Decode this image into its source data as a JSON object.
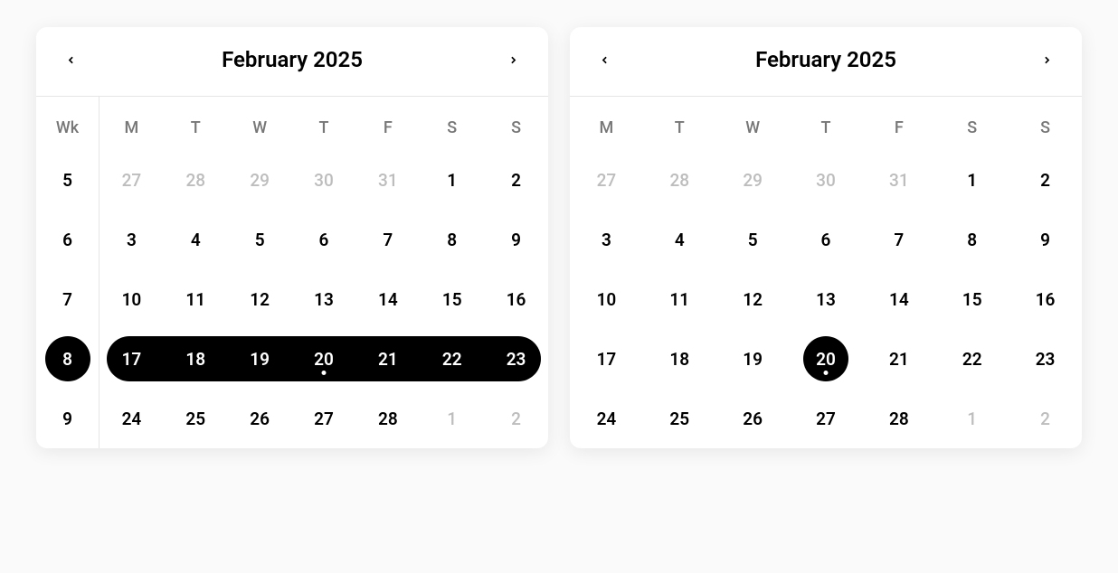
{
  "calendars": [
    {
      "id": "left",
      "title": "February 2025",
      "showWeekNumbers": true,
      "weekLabel": "Wk",
      "dayHeaders": [
        "M",
        "T",
        "W",
        "T",
        "F",
        "S",
        "S"
      ],
      "selectedWeek": 8,
      "todayDay": 20,
      "rangeStart": 17,
      "rangeEnd": 23,
      "rows": [
        {
          "wk": 5,
          "wkSelected": false,
          "days": [
            {
              "n": 27,
              "muted": true
            },
            {
              "n": 28,
              "muted": true
            },
            {
              "n": 29,
              "muted": true
            },
            {
              "n": 30,
              "muted": true
            },
            {
              "n": 31,
              "muted": true
            },
            {
              "n": 1
            },
            {
              "n": 2
            }
          ]
        },
        {
          "wk": 6,
          "wkSelected": false,
          "days": [
            {
              "n": 3
            },
            {
              "n": 4
            },
            {
              "n": 5
            },
            {
              "n": 6
            },
            {
              "n": 7
            },
            {
              "n": 8
            },
            {
              "n": 9
            }
          ]
        },
        {
          "wk": 7,
          "wkSelected": false,
          "days": [
            {
              "n": 10
            },
            {
              "n": 11
            },
            {
              "n": 12
            },
            {
              "n": 13
            },
            {
              "n": 14
            },
            {
              "n": 15
            },
            {
              "n": 16
            }
          ]
        },
        {
          "wk": 8,
          "wkSelected": true,
          "days": [
            {
              "n": 17,
              "inRange": true,
              "rangeEdge": "left"
            },
            {
              "n": 18,
              "inRange": true
            },
            {
              "n": 19,
              "inRange": true
            },
            {
              "n": 20,
              "inRange": true,
              "today": true
            },
            {
              "n": 21,
              "inRange": true
            },
            {
              "n": 22,
              "inRange": true
            },
            {
              "n": 23,
              "inRange": true,
              "rangeEdge": "right"
            }
          ]
        },
        {
          "wk": 9,
          "wkSelected": false,
          "days": [
            {
              "n": 24
            },
            {
              "n": 25
            },
            {
              "n": 26
            },
            {
              "n": 27
            },
            {
              "n": 28
            },
            {
              "n": 1,
              "muted": true
            },
            {
              "n": 2,
              "muted": true
            }
          ]
        }
      ]
    },
    {
      "id": "right",
      "title": "February 2025",
      "showWeekNumbers": false,
      "dayHeaders": [
        "M",
        "T",
        "W",
        "T",
        "F",
        "S",
        "S"
      ],
      "selectedDay": 20,
      "todayDay": 20,
      "rows": [
        {
          "days": [
            {
              "n": 27,
              "muted": true
            },
            {
              "n": 28,
              "muted": true
            },
            {
              "n": 29,
              "muted": true
            },
            {
              "n": 30,
              "muted": true
            },
            {
              "n": 31,
              "muted": true
            },
            {
              "n": 1
            },
            {
              "n": 2
            }
          ]
        },
        {
          "days": [
            {
              "n": 3
            },
            {
              "n": 4
            },
            {
              "n": 5
            },
            {
              "n": 6
            },
            {
              "n": 7
            },
            {
              "n": 8
            },
            {
              "n": 9
            }
          ]
        },
        {
          "days": [
            {
              "n": 10
            },
            {
              "n": 11
            },
            {
              "n": 12
            },
            {
              "n": 13
            },
            {
              "n": 14
            },
            {
              "n": 15
            },
            {
              "n": 16
            }
          ]
        },
        {
          "days": [
            {
              "n": 17
            },
            {
              "n": 18
            },
            {
              "n": 19
            },
            {
              "n": 20,
              "selected": true,
              "today": true
            },
            {
              "n": 21
            },
            {
              "n": 22
            },
            {
              "n": 23
            }
          ]
        },
        {
          "days": [
            {
              "n": 24
            },
            {
              "n": 25
            },
            {
              "n": 26
            },
            {
              "n": 27
            },
            {
              "n": 28
            },
            {
              "n": 1,
              "muted": true
            },
            {
              "n": 2,
              "muted": true
            }
          ]
        }
      ]
    }
  ]
}
